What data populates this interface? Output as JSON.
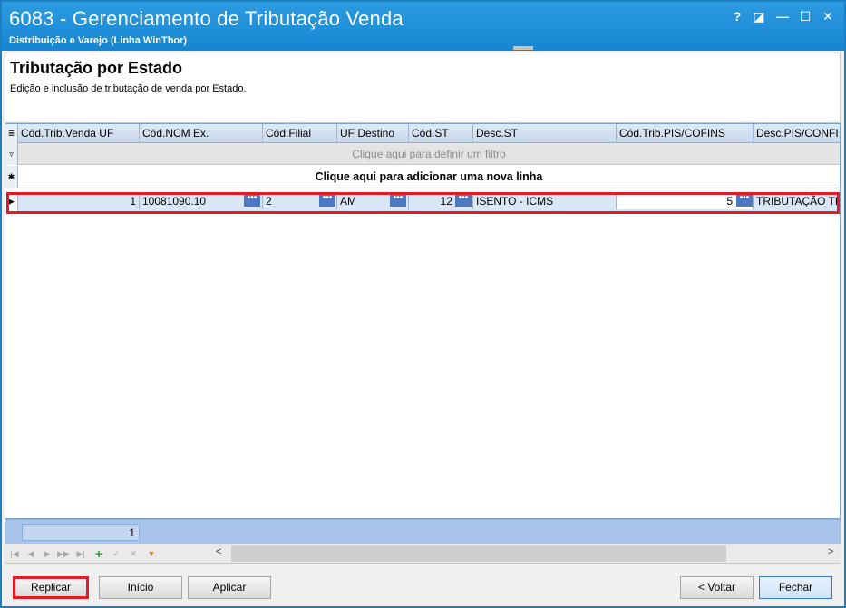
{
  "window": {
    "title": "6083 - Gerenciamento de Tributação Venda",
    "subtitle": "Distribuição e Varejo (Linha WinThor)",
    "controls": {
      "help": "?",
      "restore": "◪",
      "minimize": "—",
      "maximize": "☐",
      "close": "✕"
    }
  },
  "header": {
    "title": "Tributação por Estado",
    "description": "Edição e inclusão de tributação de venda por Estado."
  },
  "grid": {
    "columns": [
      "Cód.Trib.Venda UF",
      "Cód.NCM Ex.",
      "Cód.Filial",
      "UF Destino",
      "Cód.ST",
      "Desc.ST",
      "Cód.Trib.PIS/COFINS",
      "Desc.PIS/CONFI"
    ],
    "filter_placeholder": "Clique aqui para definir um filtro",
    "new_row_text": "Clique aqui para adicionar uma nova linha",
    "rows": [
      {
        "cod_trib_venda_uf": "1",
        "cod_ncm_ex": "10081090.10",
        "cod_filial": "2",
        "uf_destino": "AM",
        "cod_st": "12",
        "desc_st": "ISENTO - ICMS",
        "cod_trib_pis_cofins": "5",
        "desc_pis_cofins": "TRIBUTAÇÃO TE"
      }
    ],
    "ellipsis_label": "•••",
    "summary_count": "1"
  },
  "navigator": {
    "buttons": [
      "first",
      "prev",
      "next",
      "next-page",
      "last",
      "add",
      "confirm",
      "cancel",
      "filter"
    ],
    "scroll_left": "<",
    "scroll_right": ">"
  },
  "footer": {
    "replicar": "Replicar",
    "inicio": "Início",
    "aplicar": "Aplicar",
    "voltar": "< Voltar",
    "fechar": "Fechar"
  },
  "colors": {
    "titlebar": "#1c8bd8",
    "selection_highlight": "#e21b24",
    "grid_row": "#d9e6f5",
    "summary_bar": "#a9c4ea"
  }
}
